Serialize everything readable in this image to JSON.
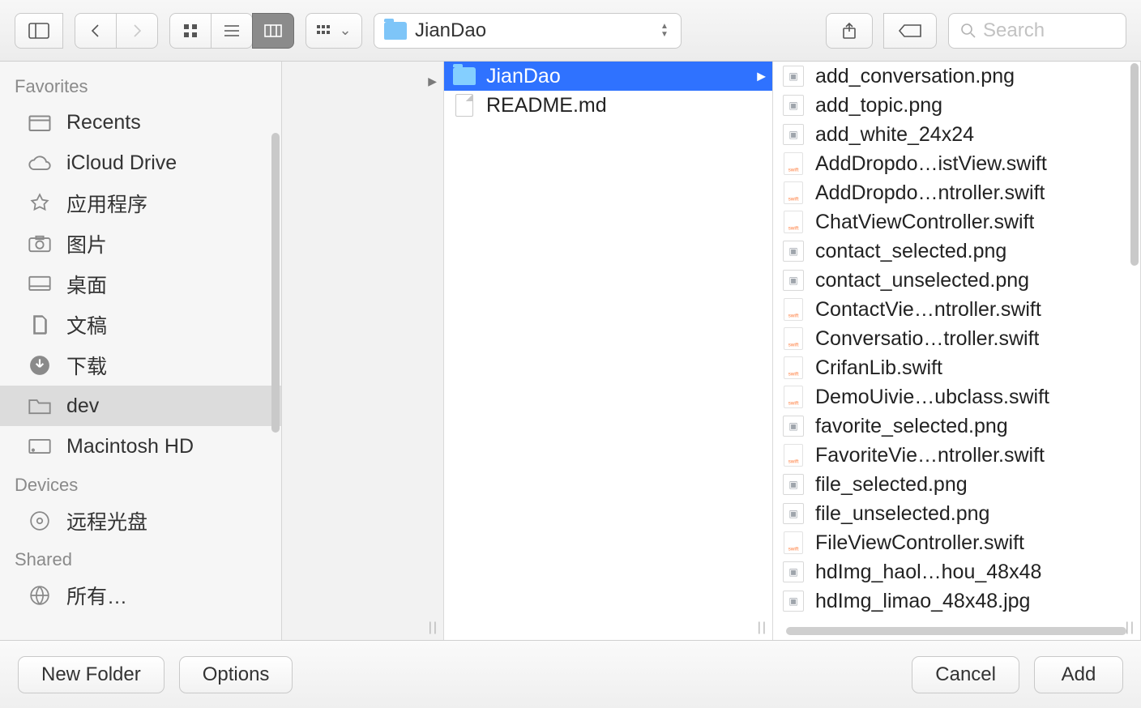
{
  "toolbar": {
    "path_label": "JianDao",
    "search_placeholder": "Search"
  },
  "sidebar": {
    "sections": [
      {
        "title": "Favorites",
        "items": [
          {
            "icon": "recents",
            "label": "Recents"
          },
          {
            "icon": "icloud",
            "label": "iCloud Drive"
          },
          {
            "icon": "apps",
            "label": "应用程序"
          },
          {
            "icon": "photos",
            "label": "图片"
          },
          {
            "icon": "desktop",
            "label": "桌面"
          },
          {
            "icon": "docs",
            "label": "文稿"
          },
          {
            "icon": "downloads",
            "label": "下载"
          },
          {
            "icon": "folder",
            "label": "dev",
            "selected": true
          },
          {
            "icon": "hd",
            "label": "Macintosh HD"
          }
        ]
      },
      {
        "title": "Devices",
        "items": [
          {
            "icon": "disc",
            "label": "远程光盘"
          }
        ]
      },
      {
        "title": "Shared",
        "items": [
          {
            "icon": "net",
            "label": "所有…"
          }
        ]
      }
    ]
  },
  "column1": [
    {
      "type": "folder",
      "name": "JianDao",
      "selected": true,
      "has_children": true
    },
    {
      "type": "file",
      "name": "README.md"
    }
  ],
  "column2": [
    {
      "type": "png",
      "name": "add_conversation.png"
    },
    {
      "type": "png",
      "name": "add_topic.png"
    },
    {
      "type": "png",
      "name": "add_white_24x24"
    },
    {
      "type": "swift",
      "name": "AddDropdo…istView.swift"
    },
    {
      "type": "swift",
      "name": "AddDropdo…ntroller.swift"
    },
    {
      "type": "swift",
      "name": "ChatViewController.swift"
    },
    {
      "type": "png",
      "name": "contact_selected.png"
    },
    {
      "type": "png",
      "name": "contact_unselected.png"
    },
    {
      "type": "swift",
      "name": "ContactVie…ntroller.swift"
    },
    {
      "type": "swift",
      "name": "Conversatio…troller.swift"
    },
    {
      "type": "swift",
      "name": "CrifanLib.swift"
    },
    {
      "type": "swift",
      "name": "DemoUivie…ubclass.swift"
    },
    {
      "type": "png",
      "name": "favorite_selected.png"
    },
    {
      "type": "swift",
      "name": "FavoriteVie…ntroller.swift"
    },
    {
      "type": "png",
      "name": "file_selected.png"
    },
    {
      "type": "png",
      "name": "file_unselected.png"
    },
    {
      "type": "swift",
      "name": "FileViewController.swift"
    },
    {
      "type": "img",
      "name": "hdImg_haol…hou_48x48"
    },
    {
      "type": "img",
      "name": "hdImg_limao_48x48.jpg"
    }
  ],
  "footer": {
    "new_folder": "New Folder",
    "options": "Options",
    "cancel": "Cancel",
    "add": "Add"
  }
}
